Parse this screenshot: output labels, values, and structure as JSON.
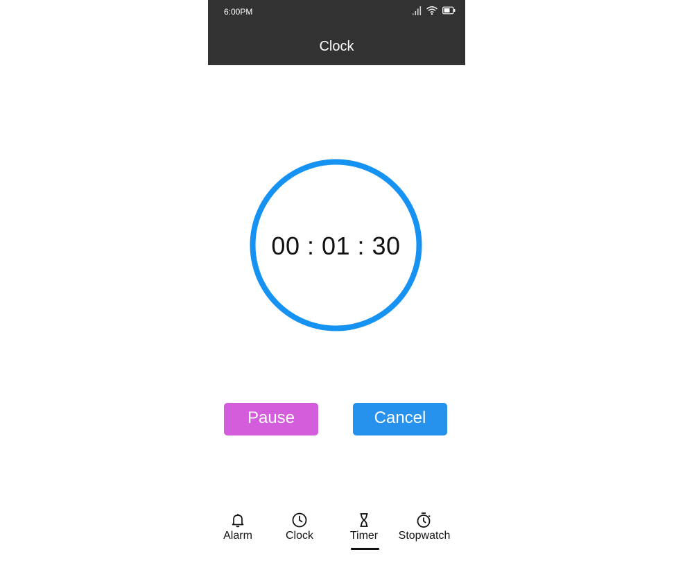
{
  "status_bar": {
    "time": "6:00PM",
    "icons": [
      "cellular-signal-icon",
      "wifi-icon",
      "battery-icon"
    ]
  },
  "header": {
    "title": "Clock"
  },
  "timer": {
    "display": "00 : 01 : 30",
    "ring_color": "#1592f2"
  },
  "actions": {
    "pause_label": "Pause",
    "pause_color": "#d35ddb",
    "cancel_label": "Cancel",
    "cancel_color": "#2791ee"
  },
  "tabs": [
    {
      "label": "Alarm",
      "icon": "bell-icon",
      "selected": false
    },
    {
      "label": "Clock",
      "icon": "clock-icon",
      "selected": false
    },
    {
      "label": "Timer",
      "icon": "hourglass-icon",
      "selected": true
    },
    {
      "label": "Stopwatch",
      "icon": "stopwatch-icon",
      "selected": false
    }
  ],
  "theme": {
    "bar_background": "#323232",
    "bar_text": "#ffffff"
  }
}
